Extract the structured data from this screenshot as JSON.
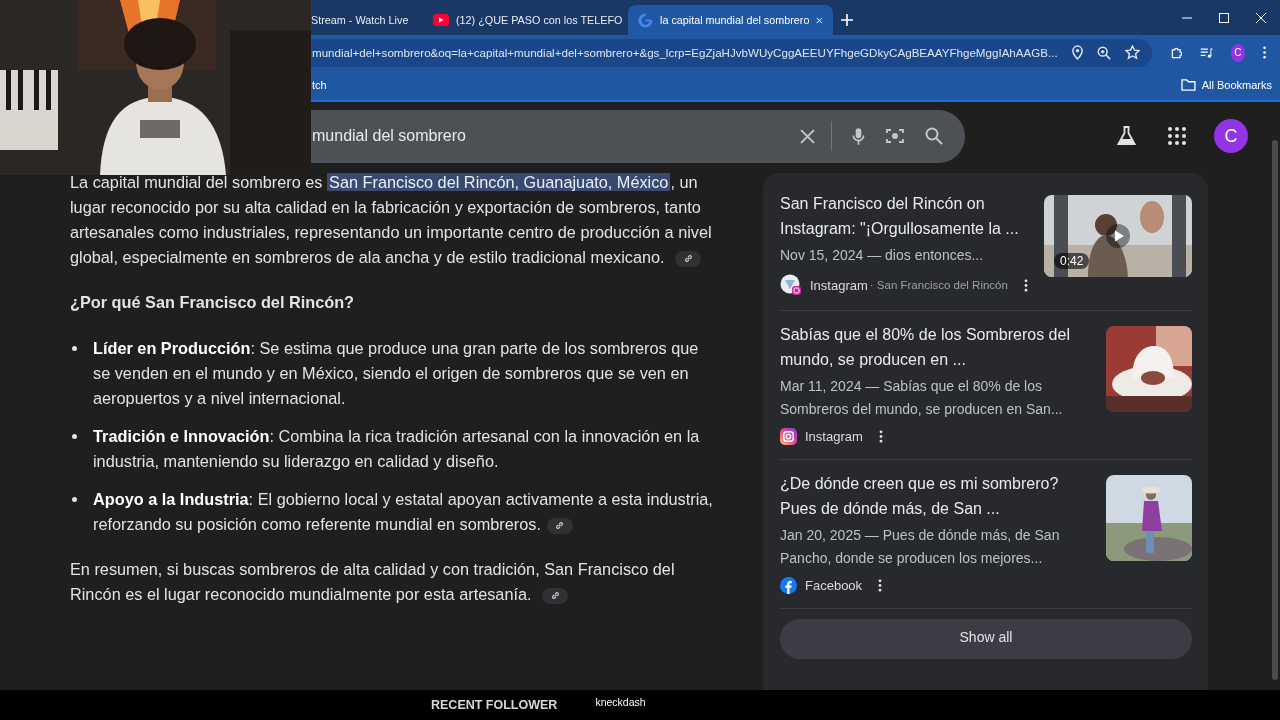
{
  "tabs": [
    {
      "title": "Stream - Watch Live",
      "kind": "plain",
      "selected": false
    },
    {
      "title": "(12) ¿QUE PASO con los TELEFO",
      "kind": "youtube",
      "selected": false
    },
    {
      "title": "la capital mundial del sombrero",
      "kind": "google",
      "selected": true
    }
  ],
  "address_bar": {
    "url": "mundial+del+sombrero&oq=la+capital+mundial+del+sombrero+&gs_lcrp=EgZjaHJvbWUyCggAEEUYFhgeGDkyCAgBEAAYFhgeMggIAhAAGB..."
  },
  "profile_avatar": "C",
  "bookmarks_bar": {
    "items": [
      {
        "label": "tch"
      }
    ],
    "all_bookmarks": "All Bookmarks"
  },
  "search": {
    "value": "mundial del sombrero"
  },
  "account_avatar": "C",
  "answer": {
    "intro": {
      "before": "La capital mundial del sombrero es ",
      "highlight": "San Francisco del Rincón, Guanajuato, México",
      "after": ", un lugar reconocido por su alta calidad en la fabricación y exportación de sombreros, tanto artesanales como industriales, representando un importante centro de producción a nivel global, especialmente en sombreros de ala ancha y de estilo tradicional mexicano.",
      "link": true
    },
    "heading": "¿Por qué San Francisco del Rincón?",
    "bullets": [
      {
        "text": "**Líder en Producción**: Se estima que produce una gran parte de los sombreros que se venden en el mundo y en México, siendo el origen de sombreros que se ven en aeropuertos y a nivel internacional.",
        "link": false
      },
      {
        "text": "**Tradición e Innovación**: Combina la rica tradición artesanal con la innovación en la industria, manteniendo su liderazgo en calidad y diseño.",
        "link": false
      },
      {
        "text": "**Apoyo a la Industria**: El gobierno local y estatal apoyan activamente a esta industria, reforzando su posición como referente mundial en sombreros.",
        "link": true
      }
    ],
    "summary": {
      "text": "En resumen, si buscas sombreros de alta calidad y con tradición, San Francisco del Rincón es el lugar reconocido mundialmente por esta artesanía.",
      "link": true
    }
  },
  "results": [
    {
      "title": "San Francisco del Rincón on Instagram: \"¡Orgullosamente la ...",
      "snippet": "Nov 15, 2024 — dios entonces...",
      "source": {
        "kind": "instagram_site",
        "name": "Instagram",
        "detail": "· San Francisco del Rincón"
      },
      "thumbnail": {
        "kind": "video",
        "duration": "0:42"
      }
    },
    {
      "title": "Sabías que el 80% de los Sombreros del mundo, se producen en ...",
      "snippet": "Mar 11, 2024 — Sabías que el 80% de los Sombreros del mundo, se producen en San...",
      "source": {
        "kind": "instagram",
        "name": "Instagram"
      }
    },
    {
      "title": "¿De dónde creen que es mi sombrero? Pues de dónde más, de San ...",
      "snippet": "Jan 20, 2025 — Pues de dónde más, de San Pancho, donde se producen los mejores...",
      "source": {
        "kind": "facebook",
        "name": "Facebook"
      }
    }
  ],
  "show_all": "Show all",
  "stream_overlay": {
    "label": "RECENT FOLLOWER",
    "name": "kneckdash"
  }
}
